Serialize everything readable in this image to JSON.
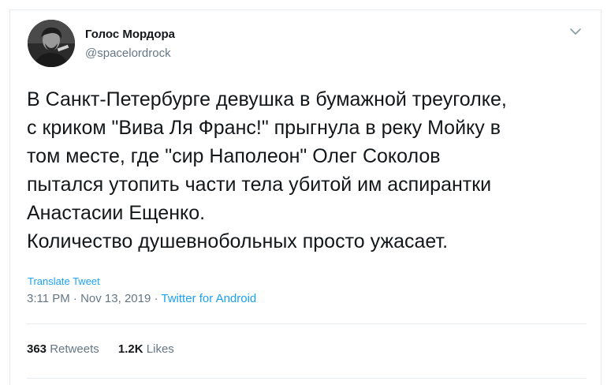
{
  "author": {
    "name": "Голос Мордора",
    "handle": "@spacelordrock"
  },
  "tweet": {
    "lines": [
      "В Санкт-Петербурге девушка в бумажной треуголке,",
      "с криком \"Вива Ля Франс!\" прыгнула в реку Мойку в",
      "том месте, где \"сир Наполеон\" Олег Соколов",
      "пытался утопить части тела убитой им аспирантки",
      "Анастасии Ещенко.",
      "Количество душевнобольных просто ужасает."
    ]
  },
  "translate_label": "Translate Tweet",
  "meta": {
    "time": "3:11 PM",
    "separator": " · ",
    "date": "Nov 13, 2019",
    "source": "Twitter for Android"
  },
  "stats": {
    "retweets_count": "363",
    "retweets_label": "Retweets",
    "likes_count": "1.2K",
    "likes_label": "Likes"
  },
  "icons": {
    "menu": "chevron-down-icon"
  },
  "colors": {
    "accent": "#1da1f2",
    "secondary_text": "#657786",
    "primary_text": "#14171a"
  }
}
